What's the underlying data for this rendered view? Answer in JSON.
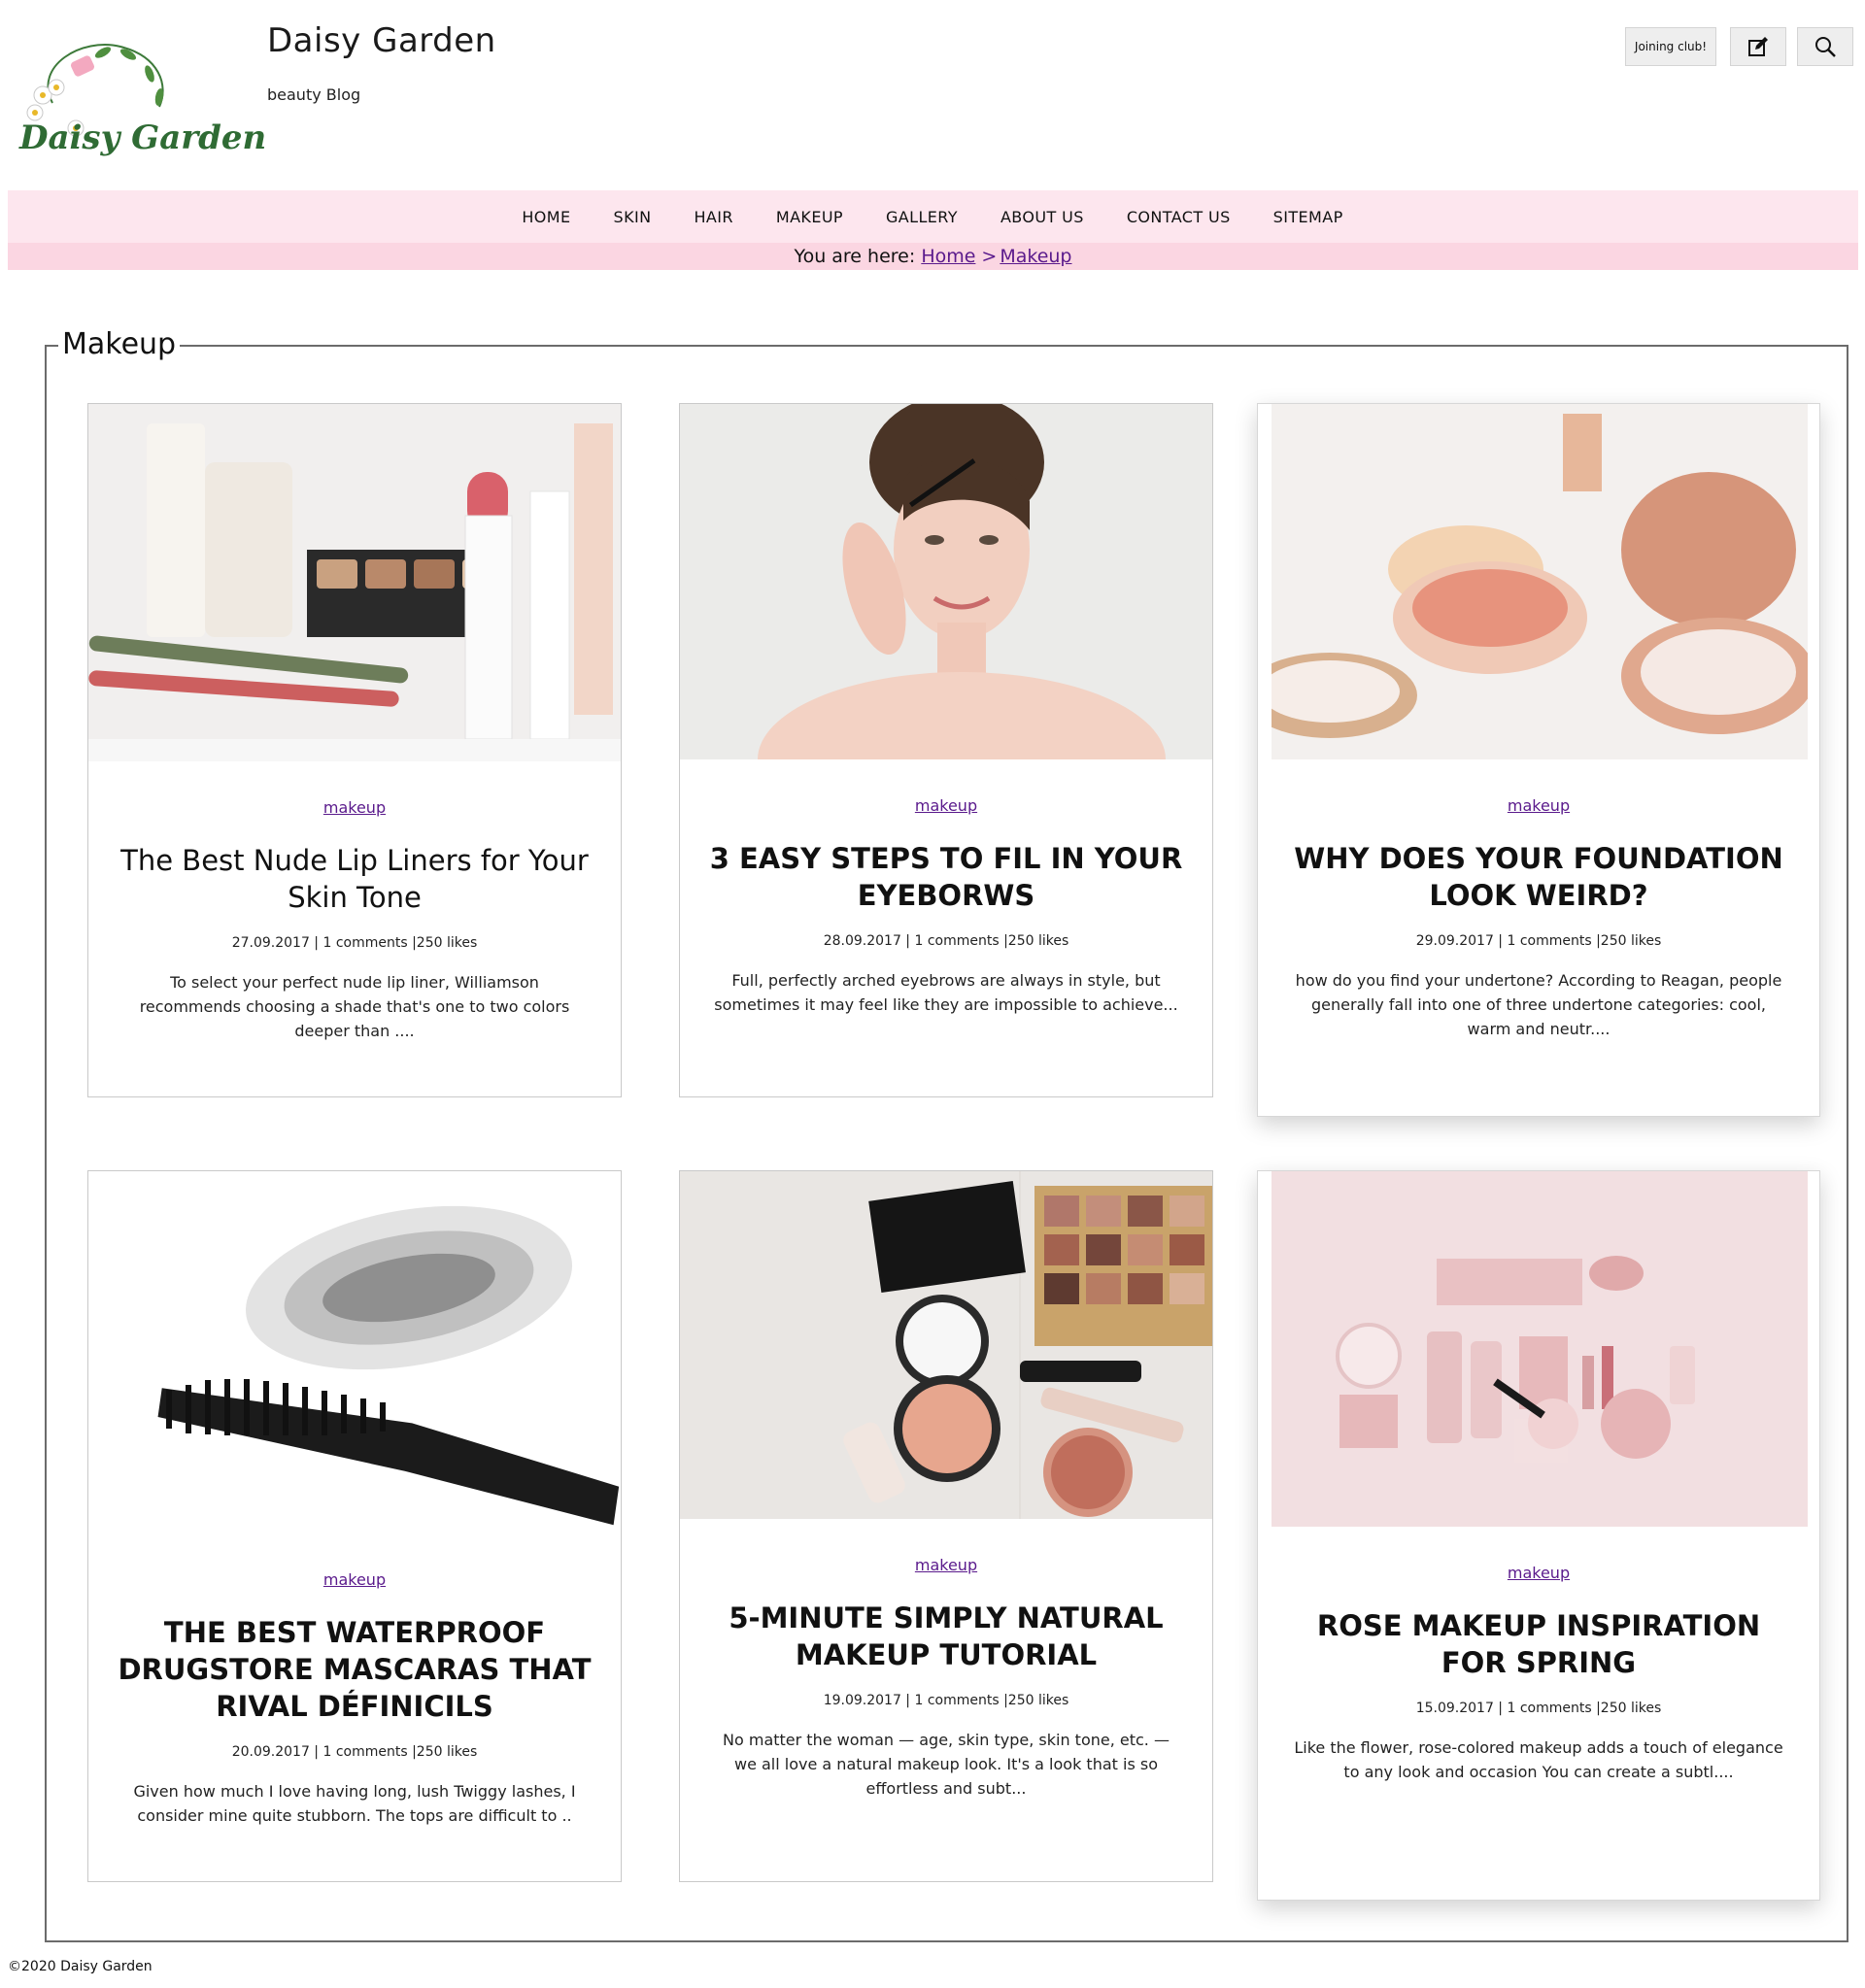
{
  "header": {
    "logo_text": "Daisy Garden",
    "site_title": "Daisy Garden",
    "tagline": "beauty Blog",
    "join_label": "Joining club!",
    "edit_icon": "edit-icon",
    "search_icon": "search-icon"
  },
  "nav": {
    "items": [
      "HOME",
      "SKIN",
      "HAIR",
      "MAKEUP",
      "GALLERY",
      "ABOUT US",
      "CONTACT US",
      "SITEMAP"
    ]
  },
  "breadcrumb": {
    "prefix": "You are here:",
    "home": "Home",
    "separator": ">",
    "current": "Makeup"
  },
  "section": {
    "title": "Makeup"
  },
  "posts": [
    {
      "category": "makeup",
      "title": "The Best Nude Lip Liners for Your Skin Tone",
      "meta": "27.09.2017 | 1 comments |250 likes",
      "excerpt": "To select your perfect nude lip liner, Williamson recommends choosing a shade that's one to two colors deeper than ....",
      "image": "lipstick-and-cosmetics-photo"
    },
    {
      "category": "makeup",
      "title": "3 EASY STEPS TO FIL IN YOUR EYEBORWS",
      "meta": "28.09.2017 | 1 comments |250 likes",
      "excerpt": "Full, perfectly arched eyebrows are always in style, but sometimes it may feel like they are impossible to achieve...",
      "image": "woman-brushing-eyebrows-photo"
    },
    {
      "category": "makeup",
      "title": "WHY DOES YOUR FOUNDATION LOOK WEIRD?",
      "meta": "29.09.2017 | 1 comments |250 likes",
      "excerpt": "how do you find your undertone? According to Reagan, people generally fall into one of three undertone categories: cool, warm and neutr....",
      "image": "loose-powder-jars-photo"
    },
    {
      "category": "makeup",
      "title": "THE BEST WATERPROOF DRUGSTORE MASCARAS THAT RIVAL DÉFINICILS",
      "meta": "20.09.2017 | 1 comments |250 likes",
      "excerpt": "Given how much I love having long, lush Twiggy lashes, I consider mine quite stubborn. The tops are difficult to ..",
      "image": "mascara-wand-photo"
    },
    {
      "category": "makeup",
      "title": "5-MINUTE SIMPLY NATURAL MAKEUP TUTORIAL",
      "meta": "19.09.2017 | 1 comments |250 likes",
      "excerpt": "No matter the woman — age, skin type, skin tone, etc. — we all love a natural makeup look. It's a look that is so effortless and subt...",
      "image": "makeup-palette-flatlay-photo"
    },
    {
      "category": "makeup",
      "title": "ROSE MAKEUP INSPIRATION FOR SPRING",
      "meta": "15.09.2017 | 1 comments |250 likes",
      "excerpt": "Like the flower, rose-colored makeup adds a touch of elegance to any look and occasion You can create a subtl....",
      "image": "pink-cosmetics-flatlay-photo"
    }
  ],
  "footer": {
    "copyright": "©2020 Daisy Garden"
  }
}
